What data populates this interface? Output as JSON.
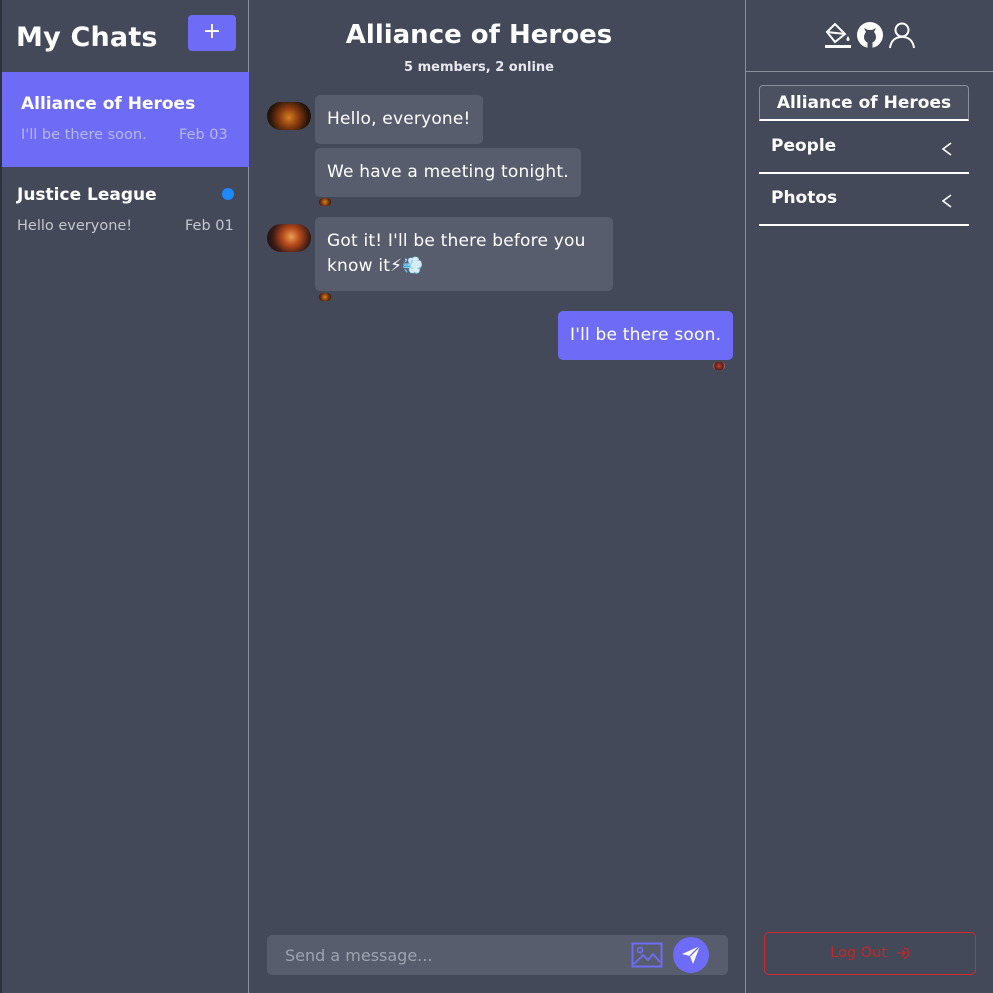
{
  "sidebar": {
    "title": "My Chats",
    "new_chat_label": "+",
    "chats": [
      {
        "name": "Alliance of Heroes",
        "preview": "I'll be there soon.",
        "date": "Feb 03",
        "active": true,
        "unread": false
      },
      {
        "name": "Justice League",
        "preview": "Hello everyone!",
        "date": "Feb 01",
        "active": false,
        "unread": true
      }
    ]
  },
  "main": {
    "title": "Alliance of Heroes",
    "subtitle": "5 members, 2 online",
    "messages": [
      {
        "text": "Hello, everyone!",
        "mine": false
      },
      {
        "text": "We have a meeting tonight.",
        "mine": false
      },
      {
        "text": "Got it! I'll be there before you know it⚡💨",
        "mine": false
      },
      {
        "text": "I'll be there soon.",
        "mine": true
      }
    ],
    "composer": {
      "placeholder": "Send a message..."
    }
  },
  "right_panel": {
    "header_icons": [
      "paint-bucket-icon",
      "github-icon",
      "user-icon"
    ],
    "group_name": "Alliance of Heroes",
    "sections": [
      {
        "label": "People"
      },
      {
        "label": "Photos"
      }
    ],
    "logout_label": "Log Out"
  },
  "colors": {
    "background": "#434958",
    "accent": "#6e6cf7",
    "bubble": "#575d6d",
    "unread_dot": "#1e88ff",
    "logout": "#c12828"
  }
}
